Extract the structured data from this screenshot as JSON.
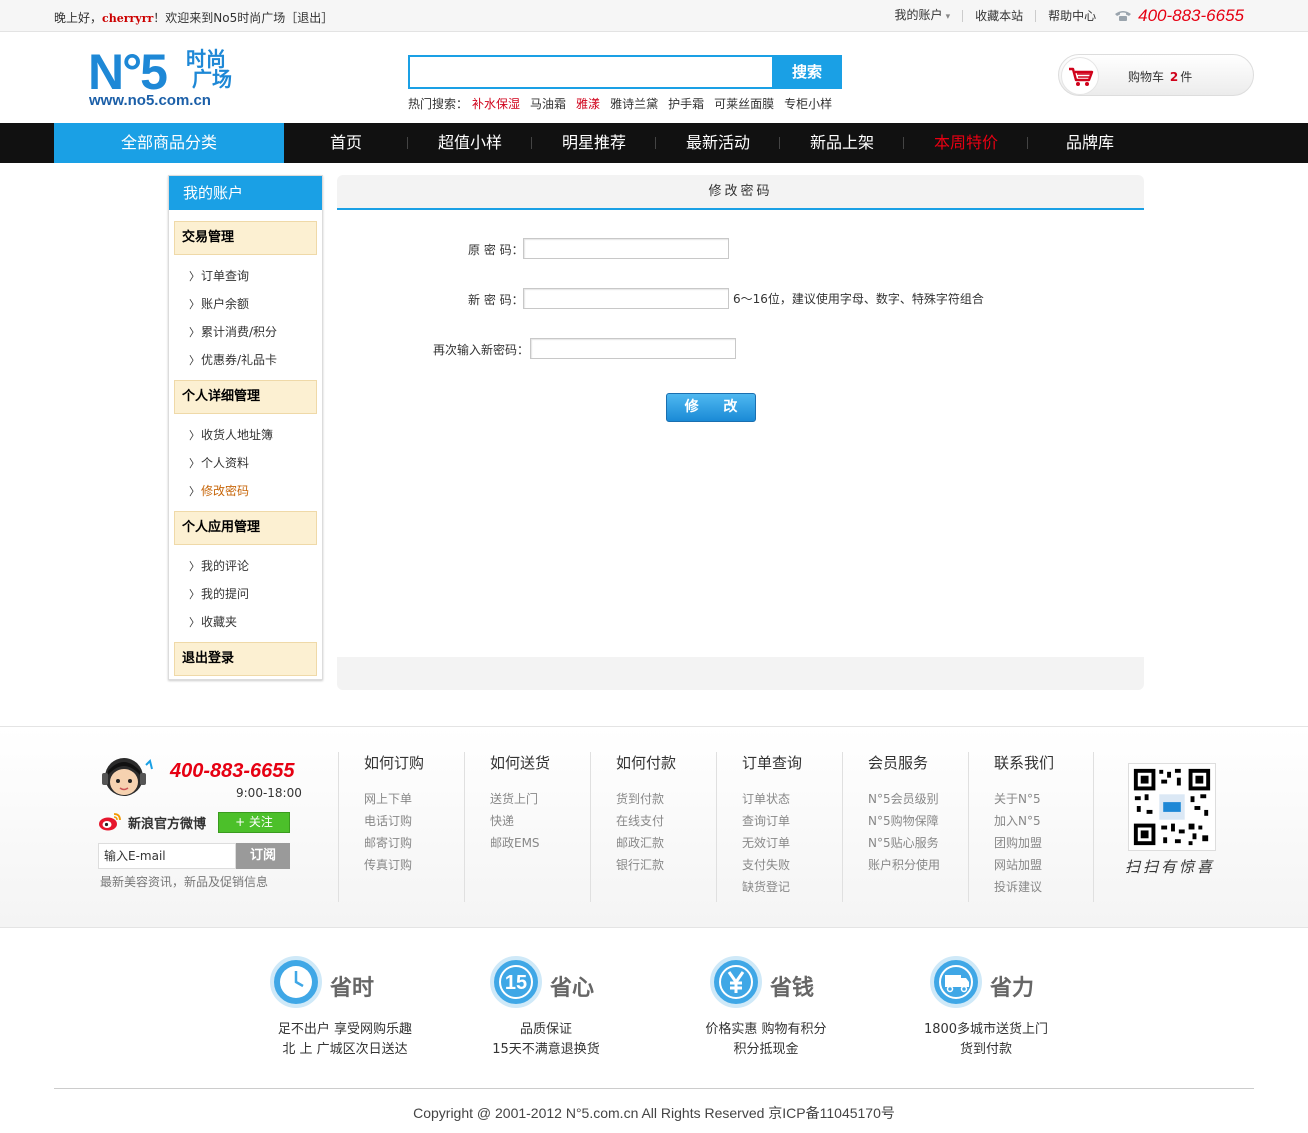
{
  "topbar": {
    "greeting_prefix": "晚上好，",
    "username": "cherryrr",
    "greeting_suffix": "！欢迎来到No5时尚广场［退出］",
    "my_account": "我的账户",
    "favorite": "收藏本站",
    "help": "帮助中心",
    "phone": "400-883-6655"
  },
  "header": {
    "logo_main": "N°5",
    "logo_cn1": "时尚",
    "logo_cn2": "广场",
    "logo_url": "www.no5.com.cn",
    "search_placeholder": "",
    "search_button": "搜索",
    "hot_label": "热门搜索：",
    "hot_terms": [
      "补水保湿",
      "马油霜",
      "雅漾",
      "雅诗兰黛",
      "护手霜",
      "可莱丝面膜",
      "专柜小样"
    ],
    "cart_label": "购物车",
    "cart_count": "2",
    "cart_unit": "件"
  },
  "nav": {
    "all_categories": "全部商品分类",
    "items": [
      "首页",
      "超值小样",
      "明星推荐",
      "最新活动",
      "新品上架",
      "本周特价",
      "品牌库"
    ],
    "highlight_color": "#e60012"
  },
  "sidebar": {
    "title": "我的账户",
    "groups": [
      {
        "title": "交易管理",
        "items": [
          "订单查询",
          "账户余额",
          "累计消费/积分",
          "优惠券/礼品卡"
        ]
      },
      {
        "title": "个人详细管理",
        "items": [
          "收货人地址簿",
          "个人资料",
          "修改密码"
        ]
      },
      {
        "title": "个人应用管理",
        "items": [
          "我的评论",
          "我的提问",
          "收藏夹"
        ]
      },
      {
        "title": "退出登录",
        "items": []
      }
    ],
    "active_item": "修改密码"
  },
  "main": {
    "title": "修改密码",
    "old_label": "原 密 码：",
    "new_label": "新 密 码：",
    "confirm_label": "再次输入新密码：",
    "hint": "6～16位，建议使用字母、数字、特殊字符组合",
    "submit": "修 改"
  },
  "footer": {
    "service_phone": "400-883-6655",
    "service_hours": "9:00-18:00",
    "weibo": "新浪官方微博",
    "follow": "+ 关注",
    "email_placeholder": "输入E-mail",
    "subscribe": "订阅",
    "email_note": "最新美容资讯，新品及促销信息",
    "columns": [
      {
        "title": "如何订购",
        "links": [
          "网上下单",
          "电话订购",
          "邮寄订购",
          "传真订购"
        ]
      },
      {
        "title": "如何送货",
        "links": [
          "送货上门",
          "快递",
          "邮政EMS"
        ]
      },
      {
        "title": "如何付款",
        "links": [
          "货到付款",
          "在线支付",
          "邮政汇款",
          "银行汇款"
        ]
      },
      {
        "title": "订单查询",
        "links": [
          "订单状态",
          "查询订单",
          "无效订单",
          "支付失败",
          "缺货登记"
        ]
      },
      {
        "title": "会员服务",
        "links": [
          "N°5会员级别",
          "N°5购物保障",
          "N°5贴心服务",
          "账户积分使用"
        ]
      },
      {
        "title": "联系我们",
        "links": [
          "关于N°5",
          "加入N°5",
          "团购加盟",
          "网站加盟",
          "投诉建议"
        ]
      }
    ],
    "qr_caption": "扫扫有惊喜",
    "benefits": [
      {
        "icon": "clock-icon",
        "title": "省时",
        "line1": "足不出户 享受网购乐趣",
        "line2": "北 上 广城区次日送达"
      },
      {
        "icon": "fifteen-icon",
        "title": "省心",
        "line1": "品质保证",
        "line2": "15天不满意退换货"
      },
      {
        "icon": "yen-icon",
        "title": "省钱",
        "line1": "价格实惠 购物有积分",
        "line2": "积分抵现金"
      },
      {
        "icon": "truck-icon",
        "title": "省力",
        "line1": "1800多城市送货上门",
        "line2": "货到付款"
      }
    ],
    "copyright": "Copyright @ 2001-2012 N°5.com.cn All Rights Reserved 京ICP备11045170号"
  }
}
